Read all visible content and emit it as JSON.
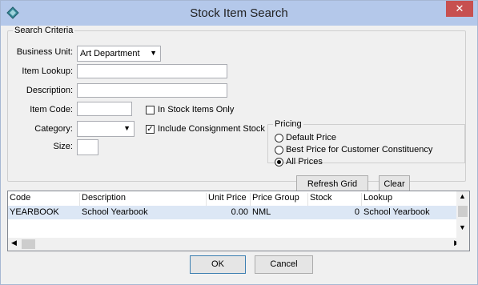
{
  "window": {
    "title": "Stock Item Search",
    "close_label": "✕"
  },
  "criteria": {
    "legend": "Search Criteria",
    "business_unit_label": "Business Unit:",
    "business_unit_value": "Art Department",
    "item_lookup_label": "Item Lookup:",
    "item_lookup_value": "",
    "description_label": "Description:",
    "description_value": "",
    "item_code_label": "Item Code:",
    "item_code_value": "",
    "category_label": "Category:",
    "category_value": "",
    "size_label": "Size:",
    "size_value": "",
    "in_stock_label": "In Stock Items Only",
    "in_stock_checked": false,
    "consignment_label": "Include Consignment Stock",
    "consignment_checked": true
  },
  "pricing": {
    "legend": "Pricing",
    "options": [
      {
        "label": "Default Price",
        "selected": false
      },
      {
        "label": "Best Price for Customer Constituency",
        "selected": false
      },
      {
        "label": "All Prices",
        "selected": true
      }
    ]
  },
  "buttons": {
    "refresh": "Refresh Grid",
    "clear": "Clear",
    "ok": "OK",
    "cancel": "Cancel"
  },
  "grid": {
    "columns": [
      "Code",
      "Description",
      "Unit Price",
      "Price Group",
      "Stock",
      "Lookup"
    ],
    "rows": [
      {
        "code": "YEARBOOK",
        "description": "School Yearbook",
        "unit_price": "0.00",
        "price_group": "NML",
        "stock": "0",
        "lookup": "School Yearbook"
      }
    ]
  },
  "colors": {
    "titlebar": "#b4c8ea",
    "close": "#c75050",
    "selected_row": "#dce7f5"
  }
}
